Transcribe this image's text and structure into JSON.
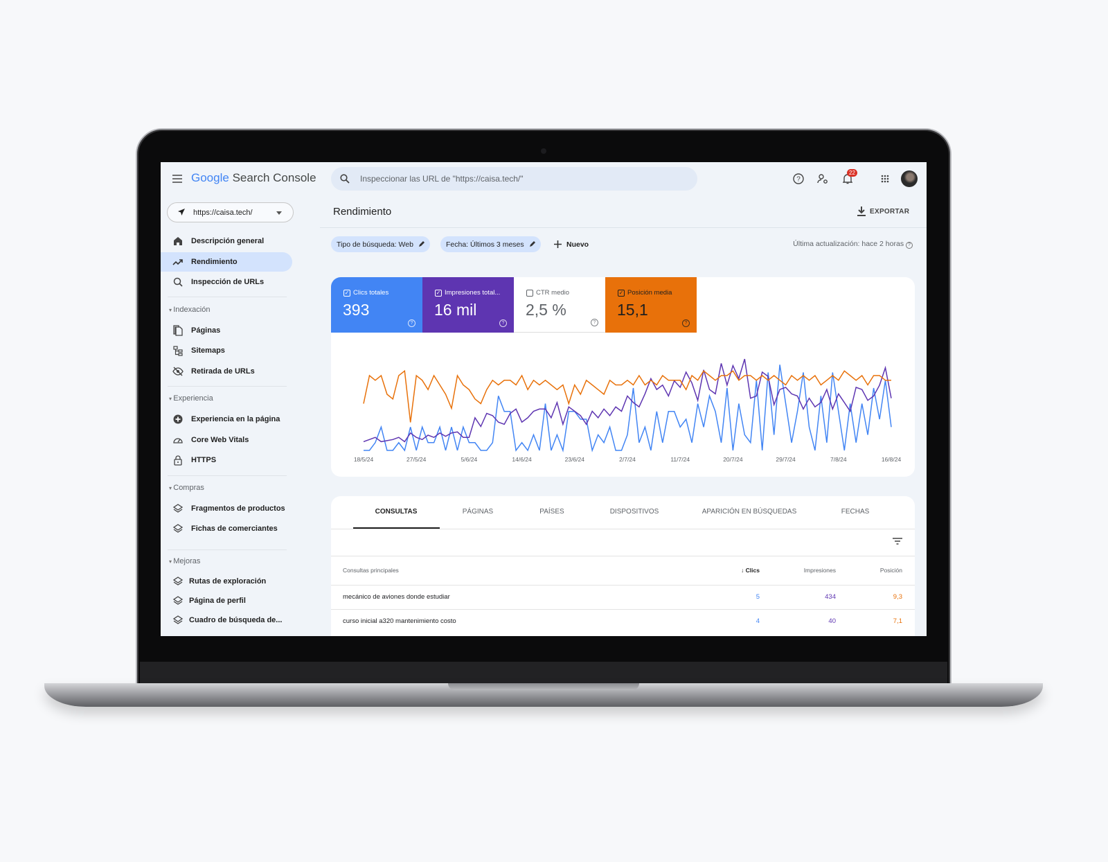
{
  "header": {
    "app_name_google": "Google",
    "app_name_product": "Search Console",
    "search_placeholder": "Inspeccionar las URL de \"https://caisa.tech/\"",
    "notification_count": "22"
  },
  "sidebar": {
    "property": "https://caisa.tech/",
    "top_items": [
      {
        "label": "Descripción general",
        "icon": "home-icon"
      },
      {
        "label": "Rendimiento",
        "icon": "trending-up-icon",
        "active": true
      },
      {
        "label": "Inspección de URLs",
        "icon": "search-icon"
      }
    ],
    "sections": [
      {
        "title": "Indexación",
        "items": [
          {
            "label": "Páginas",
            "icon": "pages-icon"
          },
          {
            "label": "Sitemaps",
            "icon": "sitemap-icon"
          },
          {
            "label": "Retirada de URLs",
            "icon": "eye-off-icon"
          }
        ]
      },
      {
        "title": "Experiencia",
        "items": [
          {
            "label": "Experiencia en la página",
            "icon": "plus-circle-icon"
          },
          {
            "label": "Core Web Vitals",
            "icon": "gauge-icon"
          },
          {
            "label": "HTTPS",
            "icon": "lock-icon"
          }
        ]
      },
      {
        "title": "Compras",
        "items": [
          {
            "label": "Fragmentos de productos",
            "icon": "layers-icon"
          },
          {
            "label": "Fichas de comerciantes",
            "icon": "layers-icon"
          }
        ]
      },
      {
        "title": "Mejoras",
        "items": [
          {
            "label": "Rutas de exploración",
            "icon": "layers-icon"
          },
          {
            "label": "Página de perfil",
            "icon": "layers-icon"
          },
          {
            "label": "Cuadro de búsqueda de...",
            "icon": "layers-icon"
          }
        ]
      }
    ]
  },
  "main": {
    "title": "Rendimiento",
    "export_label": "EXPORTAR",
    "filters": [
      "Tipo de búsqueda: Web",
      "Fecha: Últimos 3 meses"
    ],
    "new_filter_label": "Nuevo",
    "last_updated": "Última actualización: hace 2 horas",
    "metrics": [
      {
        "label": "Clics totales",
        "value": "393",
        "checked": true,
        "color": "#4285f4"
      },
      {
        "label": "Impresiones total...",
        "value": "16 mil",
        "checked": true,
        "color": "#5e35b1"
      },
      {
        "label": "CTR medio",
        "value": "2,5 %",
        "checked": false,
        "color": "#ffffff"
      },
      {
        "label": "Posición media",
        "value": "15,1",
        "checked": true,
        "color": "#e8710a"
      }
    ],
    "tabs": [
      "CONSULTAS",
      "PÁGINAS",
      "PAÍSES",
      "DISPOSITIVOS",
      "APARICIÓN EN BÚSQUEDAS",
      "FECHAS"
    ],
    "table": {
      "columns": [
        "Consultas principales",
        "Clics",
        "Impresiones",
        "Posición"
      ],
      "sort_column": "Clics",
      "rows": [
        {
          "query": "mecánico de aviones donde estudiar",
          "clicks": "5",
          "impressions": "434",
          "position": "9,3"
        },
        {
          "query": "curso inicial a320 mantenimiento costo",
          "clicks": "4",
          "impressions": "40",
          "position": "7,1"
        }
      ]
    }
  },
  "chart_data": {
    "type": "line",
    "x_start": "18/5/24",
    "x_end": "16/8/24",
    "x_ticks": [
      "18/5/24",
      "27/5/24",
      "5/6/24",
      "14/6/24",
      "23/6/24",
      "2/7/24",
      "11/7/24",
      "20/7/24",
      "29/7/24",
      "7/8/24",
      "16/8/24"
    ],
    "grid": false,
    "series": [
      {
        "name": "Clics totales",
        "color": "#4285f4",
        "ylim": [
          0,
          12
        ],
        "values": [
          0,
          0,
          1,
          3,
          0,
          0,
          1,
          0,
          3,
          0,
          3,
          1,
          1,
          3,
          0,
          3,
          0,
          3,
          1,
          1,
          0,
          0,
          1,
          7,
          5,
          5,
          0,
          1,
          0,
          2,
          0,
          6,
          0,
          2,
          0,
          5,
          5,
          4,
          4,
          0,
          2,
          1,
          3,
          0,
          0,
          2,
          8,
          1,
          3,
          0,
          5,
          1,
          5,
          5,
          3,
          4,
          1,
          6,
          3,
          7,
          5,
          1,
          8,
          0,
          6,
          2,
          1,
          9,
          0,
          10,
          2,
          11,
          6,
          1,
          5,
          10,
          3,
          0,
          7,
          1,
          10,
          5,
          0,
          6,
          1,
          6,
          2,
          8,
          4,
          9,
          3
        ]
      },
      {
        "name": "Impresiones totales",
        "color": "#5e35b1",
        "ylim": [
          0,
          430
        ],
        "values": [
          40,
          50,
          60,
          40,
          45,
          50,
          60,
          40,
          80,
          60,
          50,
          70,
          60,
          80,
          65,
          80,
          85,
          60,
          60,
          150,
          110,
          170,
          160,
          130,
          120,
          170,
          190,
          130,
          150,
          180,
          190,
          190,
          150,
          220,
          120,
          200,
          180,
          160,
          120,
          180,
          150,
          190,
          160,
          200,
          180,
          250,
          220,
          200,
          260,
          330,
          280,
          300,
          250,
          320,
          290,
          360,
          310,
          230,
          370,
          280,
          260,
          400,
          300,
          390,
          330,
          420,
          240,
          250,
          360,
          340,
          210,
          280,
          290,
          260,
          250,
          190,
          240,
          200,
          220,
          280,
          190,
          260,
          220,
          180,
          290,
          280,
          230,
          250,
          300,
          380,
          240
        ]
      },
      {
        "name": "Posición media",
        "color": "#e8710a",
        "ylim": [
          30,
          10
        ],
        "inverted": true,
        "values": [
          20,
          14,
          15,
          14,
          18,
          19,
          14,
          13,
          24,
          14,
          15,
          17,
          14,
          16,
          18,
          21,
          14,
          16,
          17,
          19,
          20,
          17,
          15,
          16,
          15,
          15,
          16,
          14,
          17,
          15,
          16,
          15,
          16,
          17,
          16,
          20,
          16,
          18,
          15,
          16,
          17,
          18,
          15,
          16,
          16,
          15,
          16,
          14,
          16,
          15,
          16,
          14,
          15,
          15,
          15,
          17,
          14,
          15,
          13,
          14,
          15,
          14,
          14,
          13,
          15,
          14,
          14,
          15,
          14,
          15,
          14,
          15,
          16,
          14,
          15,
          14,
          15,
          14,
          16,
          15,
          14,
          15,
          13,
          14,
          15,
          14,
          16,
          14,
          14,
          15,
          15
        ]
      }
    ]
  }
}
